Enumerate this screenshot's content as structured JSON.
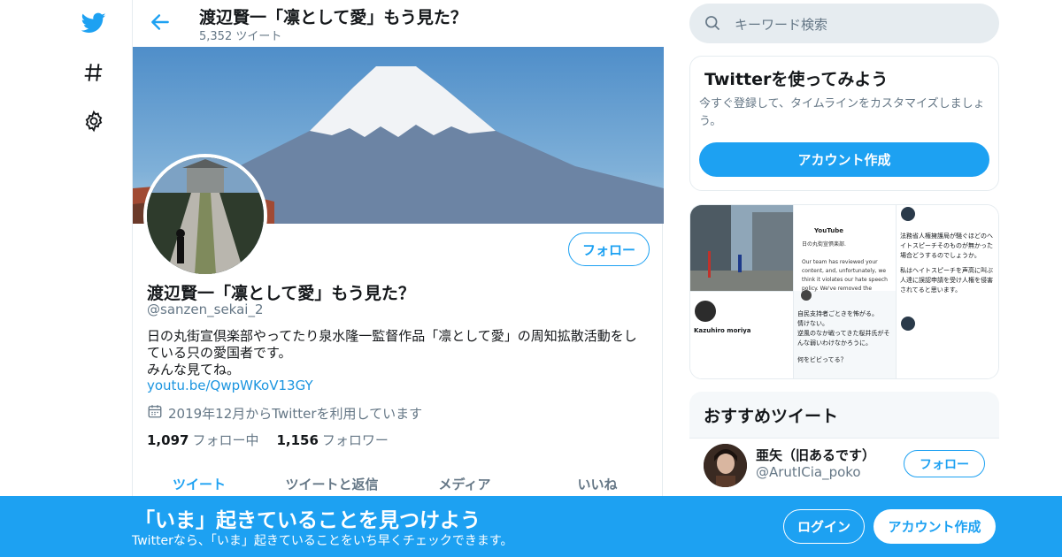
{
  "header": {
    "title": "渡辺賢一「凛として愛」もう見た？",
    "tweet_count": "5,352 ツイート"
  },
  "profile": {
    "name": "渡辺賢一「凛として愛」もう見た？",
    "handle": "@sanzen_sekai_2",
    "bio_line1": "日の丸街宣倶楽部やってたり泉水隆一監督作品「凛として愛」の周知拡散活動をし",
    "bio_line2": "ている只の愛国者です。",
    "bio_line3": "みんな見てね。",
    "link": "youtu.be/QwpWKoV13GY",
    "joined": "2019年12月からTwitterを利用しています",
    "following_count": "1,097",
    "following_label": "フォロー中",
    "followers_count": "1,156",
    "followers_label": "フォロワー",
    "follow_button": "フォロー"
  },
  "tabs": [
    "ツイート",
    "ツイートと返信",
    "メディア",
    "いいね"
  ],
  "search": {
    "placeholder": "キーワード検索"
  },
  "signup_card": {
    "title": "Twitterを使ってみよう",
    "desc": "今すぐ登録して、タイムラインをカスタマイズしましょう。",
    "button": "アカウント作成"
  },
  "recommend": {
    "title": "おすすめツイート",
    "user_name": "亜矢（旧あるです）",
    "user_handle": "@ArutICia_poko",
    "button": "フォロー"
  },
  "media_texts": {
    "yt_name": "YouTube",
    "yt_line1": "日の丸街宣倶楽部.",
    "yt_line2": "Our team has reviewed your",
    "yt_line3": "content, and, unfortunately, we",
    "yt_line4": "think it violates our hate speech",
    "yt_line5": "policy. We've removed the",
    "tw_a1": "法務省人権擁護局が騒ぐほどのへ",
    "tw_a2": "イトスピーチそのものが無かった",
    "tw_a3": "場合どうするのでしょうか。",
    "tw_a4": "私はヘイトスピーチを声高に叫ぶ",
    "tw_a5": "人達に誤認申請を受け人権を侵害",
    "tw_a6": "されてると思います。",
    "tw_b1": "自民支持者ごときを怖がる。",
    "tw_b2": "情けない。",
    "tw_b3": "逆風のなか戦ってきた桜井氏がそ",
    "tw_b4": "んな弱いわけなかろうに。",
    "tw_b5": "何をビビってる？",
    "kz_name": "Kazuhiro moriya"
  },
  "bottom_bar": {
    "title": "「いま」起きていることを見つけよう",
    "subtitle": "Twitterなら、「いま」起きていることをいち早くチェックできます。",
    "login": "ログイン",
    "signup": "アカウント作成"
  },
  "colors": {
    "accent": "#1da1f2",
    "muted": "#657786",
    "link": "#1b95e0"
  },
  "icons": [
    "twitter-bird-icon",
    "hashtag-icon",
    "gear-icon",
    "back-arrow-icon",
    "search-icon",
    "calendar-icon"
  ]
}
